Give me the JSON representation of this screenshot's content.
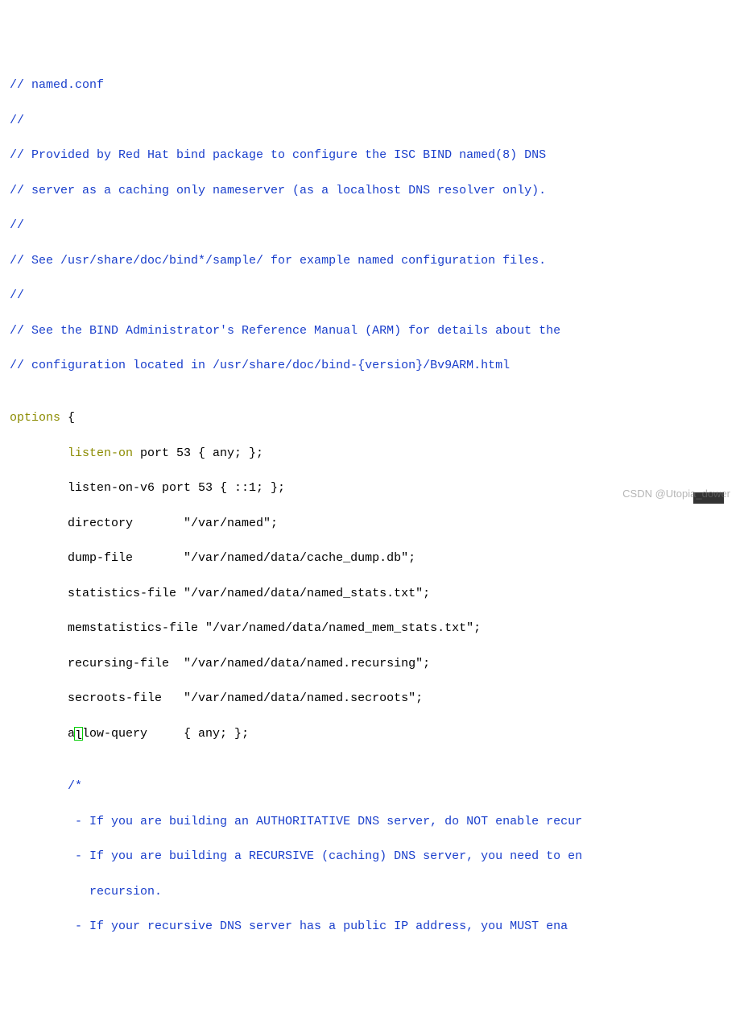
{
  "lines": {
    "c1": "// named.conf",
    "c2": "//",
    "c3": "// Provided by Red Hat bind package to configure the ISC BIND named(8) DNS",
    "c4": "// server as a caching only nameserver (as a localhost DNS resolver only).",
    "c5": "//",
    "c6": "// See /usr/share/doc/bind*/sample/ for example named configuration files.",
    "c7": "//",
    "c8": "// See the BIND Administrator's Reference Manual (ARM) for details about the",
    "c9": "// configuration located in /usr/share/doc/bind-{version}/Bv9ARM.html",
    "blank1": "",
    "options_kw": "options",
    "options_brace": " {",
    "listen_on_kw": "        listen-on",
    "listen_on_rest": " port 53 { any; };",
    "listen_v6": "        listen-on-v6 port 53 { ::1; };",
    "directory": "        directory       \"/var/named\";",
    "dump_file": "        dump-file       \"/var/named/data/cache_dump.db\";",
    "stats_file": "        statistics-file \"/var/named/data/named_stats.txt\";",
    "memstats": "        memstatistics-file \"/var/named/data/named_mem_stats.txt\";",
    "recursing": "        recursing-file  \"/var/named/data/named.recursing\";",
    "secroots": "        secroots-file   \"/var/named/data/named.secroots\";",
    "allow_pre": "        a",
    "allow_l": "l",
    "allow_post": "low-query     { any; };",
    "blank2": "",
    "cb1": "        /*",
    "cb2": "         - If you are building an AUTHORITATIVE DNS server, do NOT enable recur",
    "cb3": "         - If you are building a RECURSIVE (caching) DNS server, you need to en",
    "cb4": "           recursion.",
    "cb5": "         - If your recursive DNS server has a public IP address, you MUST ena"
  },
  "watermark": "CSDN @Utopia_dower"
}
